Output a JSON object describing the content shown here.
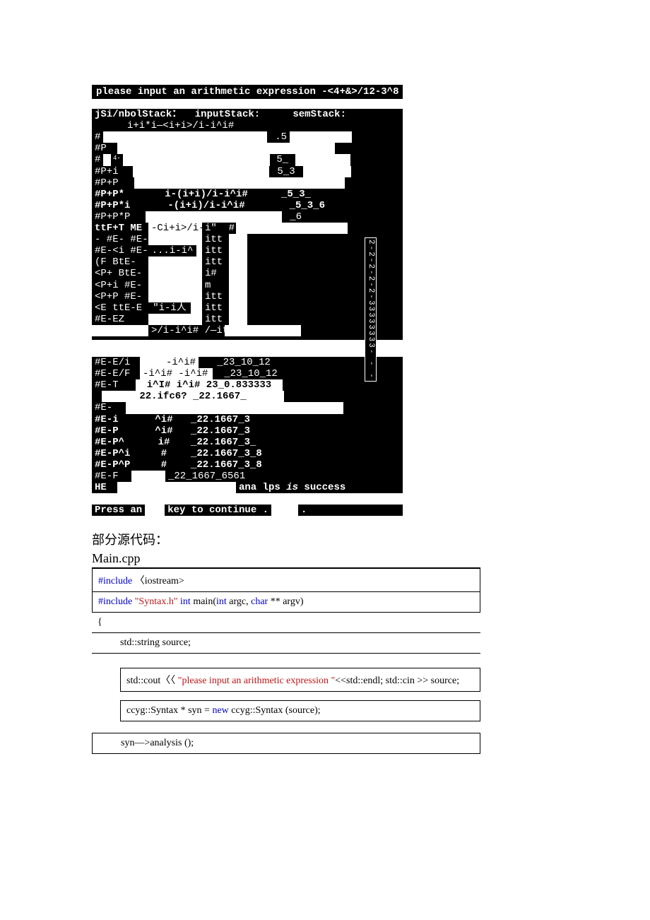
{
  "console": {
    "prompt": "please input an arithmetic expression -<4+&>/12-3^8",
    "header": {
      "symbolStack": "jSi/nbolStack：",
      "inputStack": "inputStack:",
      "semStack": "semStack:"
    },
    "line_sub": "i+i*i—<i+i>/i-i^i#",
    "rows_top": [
      {
        "c1": "#",
        "c2": "",
        "c3": ".5"
      },
      {
        "c1": "#P",
        "c2": "",
        "c3": ""
      },
      {
        "c1": "#",
        "c1b": "4-",
        "c2": "",
        "c3": "5_"
      },
      {
        "c1": "#P+i",
        "c2": "",
        "c3": "5_3"
      },
      {
        "c1": "#P+P",
        "c2": "",
        "c3": ""
      },
      {
        "c1": "#P+P*",
        "c2": "i-(i+i)/i-i^i#",
        "c3": "_5_3_"
      },
      {
        "c1": "#P+P*i",
        "c2": "-(i+i)/i-i^i#",
        "c3": "_5_3_6"
      },
      {
        "c1": "#P+P*P",
        "c2": "",
        "c3": "_6"
      },
      {
        "c1": "ttF+T ME",
        "c2": "-Ci+i>/i-",
        "c2b": "i\"  #",
        "c3": ""
      },
      {
        "c1": "- #E- #E-<",
        "c2": "",
        "c2b": "itt",
        "c3": ""
      },
      {
        "c1": "#E-<i #E-",
        "c2": "...i-i^",
        "c2b": "itt",
        "c3": ""
      },
      {
        "c1": "(F BtE-",
        "c2": "",
        "c2b": "itt",
        "c3": ""
      },
      {
        "c1": "<P+ BtE-",
        "c2": "",
        "c2b": "i#",
        "c3": ""
      },
      {
        "c1": "<P+i #E-",
        "c2": "",
        "c2b": "m",
        "c3": ""
      },
      {
        "c1": "<P+P #E-",
        "c2": "",
        "c2b": "itt",
        "c3": ""
      },
      {
        "c1": "<E ttE-E",
        "c2": "\"i-i人",
        "c2b": "itt",
        "c3": ""
      },
      {
        "c1": "#E-EZ",
        "c2": "",
        "c2b": "itt",
        "c3": ""
      },
      {
        "c1": "",
        "c2": ">/i-i^i# /—it",
        "c2b": "",
        "c3": ""
      }
    ],
    "vbar_text": "2-2-2-2-2-33333333- - -",
    "rows_mid": [
      {
        "c1": "#E-E/i",
        "c2": "-i^i#",
        "c3": "_23_10_12"
      },
      {
        "c1": "#E-E/F",
        "c2": "-i^i# -i^i# -",
        "c3": "_23_10_12"
      },
      {
        "c1": "#E-T",
        "c2": "i^I# i^i# 23_0.833333",
        "c3": ""
      },
      {
        "c1": "",
        "c2": "22.ifc6? _22.1667_",
        "c3": ""
      }
    ],
    "rows_bot": [
      {
        "c1": "#E-",
        "c2": "",
        "c3": ""
      },
      {
        "c1": "#E-i",
        "c2": "^i#",
        "c3": "_22.1667_3"
      },
      {
        "c1": "#E-P",
        "c2": "^i#",
        "c3": "_22.1667_3"
      },
      {
        "c1": "#E-P^",
        "c2": "i#",
        "c3": "_22.1667_3_"
      },
      {
        "c1": "#E-P^i",
        "c2": "#",
        "c3": "_22.1667_3_8"
      },
      {
        "c1": "#E-P^P",
        "c2": "#",
        "c3": "_22.1667_3_8"
      },
      {
        "c1": "#E-F",
        "c2": "_22_1667_6561",
        "c3": ""
      },
      {
        "c1": "HE",
        "c2": "",
        "c3": "ana lps is success",
        "c3_italic_word": "is"
      }
    ],
    "footer": {
      "press_a": "Press an",
      "press_b": "key to continue .",
      "press_c": "."
    }
  },
  "source_label": "部分源代码：",
  "filename": "Main.cpp",
  "code": {
    "l1_a": "#include",
    "l1_b": "〈iostream>",
    "l2_a": "#include",
    "l2_b": "\"Syntax.h\"",
    "l2_c": "int",
    "l2_d": "main(",
    "l2_e": "int",
    "l2_f": "argc,",
    "l2_g": "char",
    "l2_h": "** argv)",
    "l3": "{",
    "l4": "std::string source;",
    "l5_a": "std::cout〈〈",
    "l5_b": "\"please input an arithmetic expression \"",
    "l5_c": "<<std::endl; std::cin >> source;",
    "l6_a": "ccyg::Syntax * syn =",
    "l6_b": "new",
    "l6_c": "ccyg::Syntax (source);",
    "l7": "syn—>analysis ();"
  }
}
